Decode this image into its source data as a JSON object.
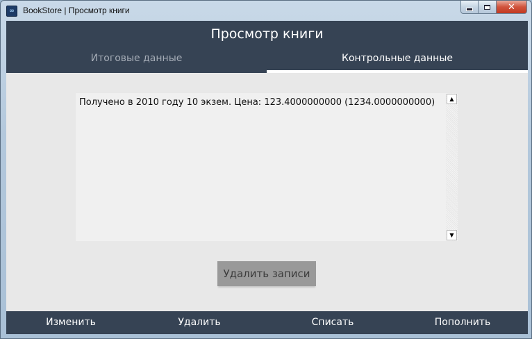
{
  "window": {
    "title": "BookStore | Просмотр книги",
    "app_icon_glyph": "∞",
    "controls": {
      "minimize": "",
      "maximize": "",
      "close": "✕"
    }
  },
  "header": {
    "title": "Просмотр книги",
    "tabs": [
      {
        "label": "Итоговые данные",
        "active": false
      },
      {
        "label": "Контрольные данные",
        "active": true
      }
    ]
  },
  "main": {
    "records_text": "Получено в 2010 году 10 экзем. Цена: 123.4000000000 (1234.0000000000)",
    "scroll_up_glyph": "▲",
    "scroll_down_glyph": "▼",
    "delete_records_label": "Удалить записи"
  },
  "footer": {
    "edit_label": "Изменить",
    "delete_label": "Удалить",
    "writeoff_label": "Списать",
    "replenish_label": "Пополнить"
  },
  "colors": {
    "header_bg": "#364354",
    "content_bg": "#e8e8e8",
    "button_bg": "#999999",
    "inactive_tab_text": "#a5acb6"
  }
}
